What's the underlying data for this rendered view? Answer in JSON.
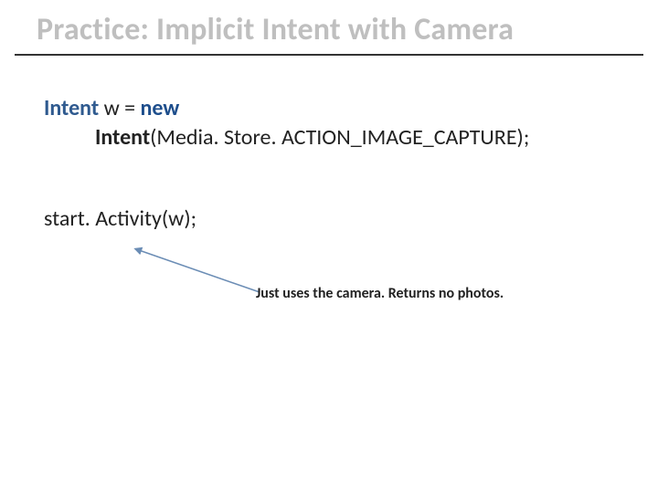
{
  "title": "Practice: Implicit Intent with Camera",
  "code": {
    "intent_type": "Intent",
    "var_decl": " w = ",
    "new_kw": "new",
    "line2_ctor": "Intent",
    "line2_args": "(Media. Store. ACTION_IMAGE_CAPTURE);",
    "line3": "start. Activity(w);"
  },
  "annotation": "Just uses the camera. Returns no photos."
}
